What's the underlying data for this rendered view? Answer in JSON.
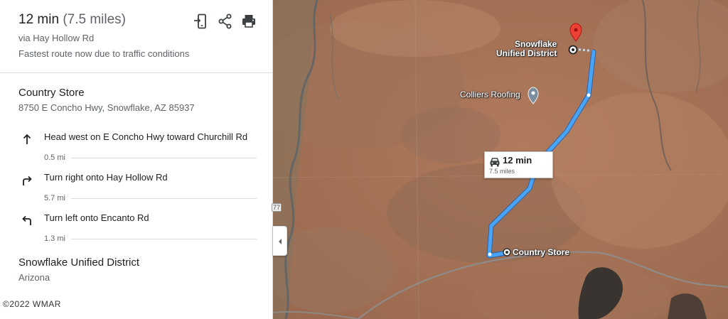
{
  "summary": {
    "duration": "12 min",
    "distance": "(7.5 miles)",
    "via": "via Hay Hollow Rd",
    "reason": "Fastest route now due to traffic conditions"
  },
  "toolbar": {
    "send_icon": "send-to-phone-icon",
    "share_icon": "share-icon",
    "print_icon": "print-icon"
  },
  "origin": {
    "name": "Country Store",
    "address": "8750 E Concho Hwy, Snowflake, AZ 85937"
  },
  "steps": [
    {
      "icon": "arrow-up-icon",
      "text": "Head west on E Concho Hwy toward Churchill Rd",
      "distance": "0.5 mi"
    },
    {
      "icon": "turn-right-icon",
      "text": "Turn right onto Hay Hollow Rd",
      "distance": "5.7 mi"
    },
    {
      "icon": "turn-left-icon",
      "text": "Turn left onto Encanto Rd",
      "distance": "1.3 mi"
    }
  ],
  "destination": {
    "name": "Snowflake Unified District",
    "region": "Arizona"
  },
  "map": {
    "labels": {
      "destination": "Snowflake Unified District",
      "destination_line1": "Snowflake",
      "destination_line2": "Unified District",
      "origin": "Country Store",
      "poi": "Colliers Roofing"
    },
    "route_badge": {
      "time": "12 min",
      "distance": "7.5 miles"
    },
    "road_shield": "77",
    "route_color": "#4aa3f5"
  },
  "watermark": "©2022 WMAR"
}
